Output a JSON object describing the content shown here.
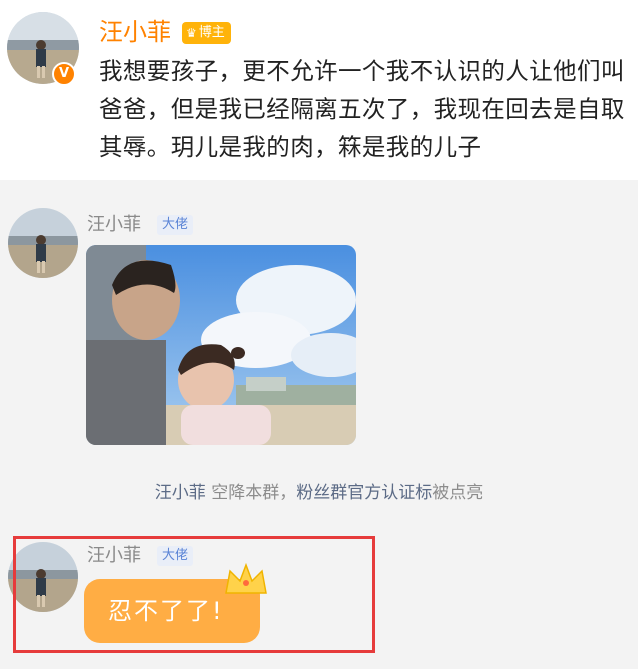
{
  "post": {
    "author": "汪小菲",
    "badge_label": "博主",
    "verified_mark": "V",
    "text": "我想要孩子，更不允许一个我不认识的人让他们叫爸爸，但是我已经隔离五次了，我现在回去是自取其辱。玥儿是我的肉，箖是我的儿子"
  },
  "chat": {
    "messages": [
      {
        "sender": "汪小菲",
        "role": "大佬",
        "type": "photo",
        "photo_desc_icon": "photo-icon"
      },
      {
        "sender": "汪小菲",
        "role": "大佬",
        "type": "text",
        "text": "忍不了了!"
      }
    ],
    "notice": {
      "name": "汪小菲",
      "middle": " 空降本群，",
      "highlight": "粉丝群官方认证标",
      "end": "被点亮"
    }
  },
  "colors": {
    "accent_orange": "#ff8200",
    "bubble": "#ffad44",
    "highlight_frame": "#e63b3b",
    "role_text": "#5b84d6"
  }
}
